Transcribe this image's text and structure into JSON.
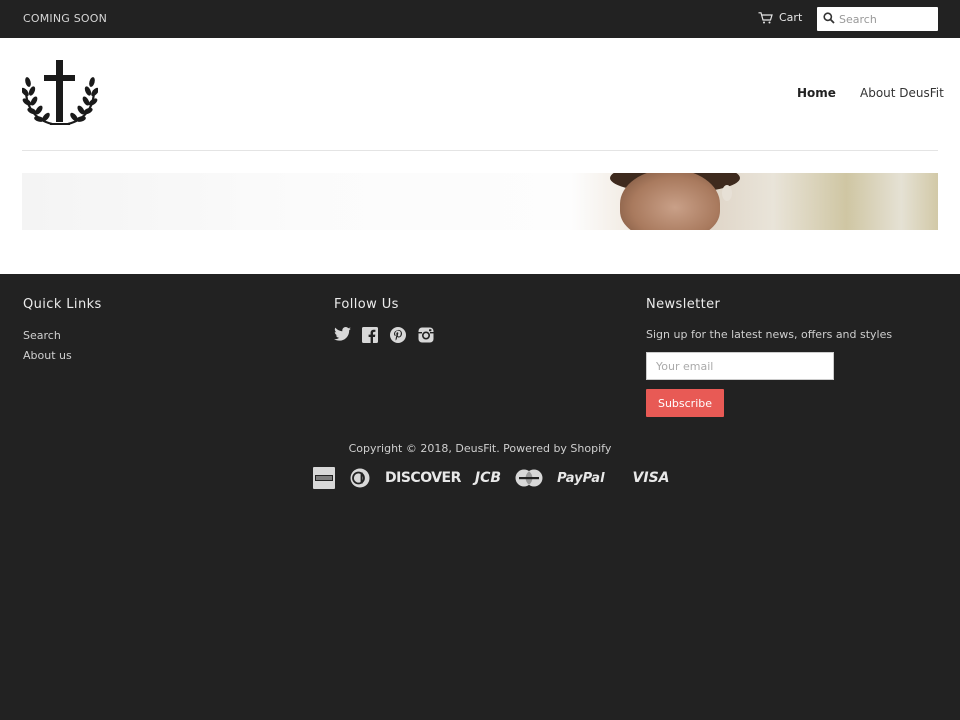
{
  "announcement": {
    "text": "COMING SOON"
  },
  "top_bar": {
    "cart_label": "Cart",
    "search_placeholder": "Search"
  },
  "header": {
    "logo_icon": "cross-laurel-logo",
    "nav": [
      {
        "label": "Home",
        "active": true
      },
      {
        "label": "About DeusFit",
        "active": false
      }
    ]
  },
  "footer": {
    "quick_links": {
      "heading": "Quick Links",
      "items": [
        "Search",
        "About us"
      ]
    },
    "follow": {
      "heading": "Follow Us",
      "icons": [
        "twitter-icon",
        "facebook-icon",
        "pinterest-icon",
        "instagram-icon"
      ]
    },
    "newsletter": {
      "heading": "Newsletter",
      "text": "Sign up for the latest news, offers and styles",
      "email_placeholder": "Your email",
      "button_label": "Subscribe"
    },
    "copyright": "Copyright © 2018, DeusFit. Powered by Shopify",
    "payments": {
      "discover": "DISCOVER",
      "jcb": "JCB",
      "paypal": "PayPal",
      "visa": "VISA"
    }
  },
  "colors": {
    "dark_bg": "#222222",
    "accent_button": "#e85a55",
    "header_bg": "#ffffff"
  }
}
